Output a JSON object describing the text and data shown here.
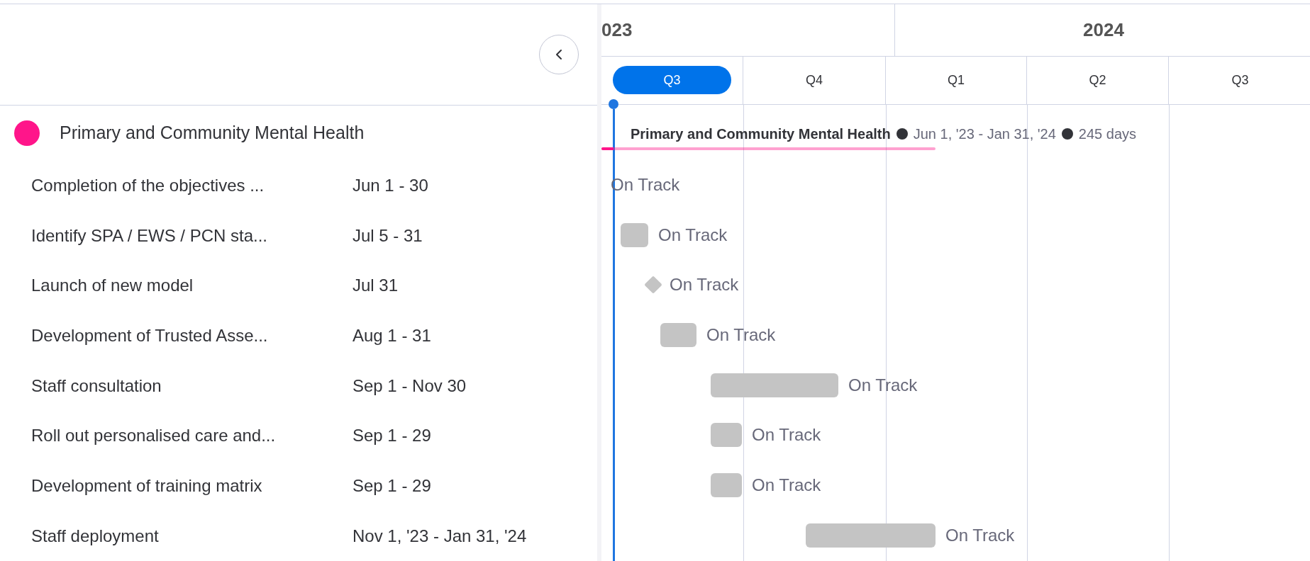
{
  "timeline": {
    "years": [
      {
        "label": "023"
      },
      {
        "label": "2024"
      }
    ],
    "quarters": [
      {
        "label": "Q3",
        "selected": true
      },
      {
        "label": "Q4",
        "selected": false
      },
      {
        "label": "Q1",
        "selected": false
      },
      {
        "label": "Q2",
        "selected": false
      },
      {
        "label": "Q3",
        "selected": false
      }
    ]
  },
  "group": {
    "name": "Primary and Community Mental Health",
    "color": "#ff158a",
    "timeline_title": "Primary and Community Mental Health",
    "date_range": "Jun 1, '23 - Jan 31, '24",
    "duration": "245 days"
  },
  "tasks": [
    {
      "name": "Completion of the objectives ...",
      "dates": "Jun 1 - 30",
      "status": "On Track",
      "kind": "none"
    },
    {
      "name": "Identify SPA / EWS / PCN sta...",
      "dates": "Jul 5 - 31",
      "status": "On Track",
      "kind": "bar"
    },
    {
      "name": "Launch of new model",
      "dates": "Jul 31",
      "status": "On Track",
      "kind": "milestone"
    },
    {
      "name": "Development of Trusted Asse...",
      "dates": "Aug 1 - 31",
      "status": "On Track",
      "kind": "bar"
    },
    {
      "name": "Staff consultation",
      "dates": "Sep 1 - Nov 30",
      "status": "On Track",
      "kind": "bar"
    },
    {
      "name": "Roll out personalised care and...",
      "dates": "Sep 1 - 29",
      "status": "On Track",
      "kind": "bar"
    },
    {
      "name": "Development of training matrix",
      "dates": "Sep 1 - 29",
      "status": "On Track",
      "kind": "bar"
    },
    {
      "name": "Staff deployment",
      "dates": "Nov 1, '23 - Jan 31, '24",
      "status": "On Track",
      "kind": "bar"
    }
  ]
}
